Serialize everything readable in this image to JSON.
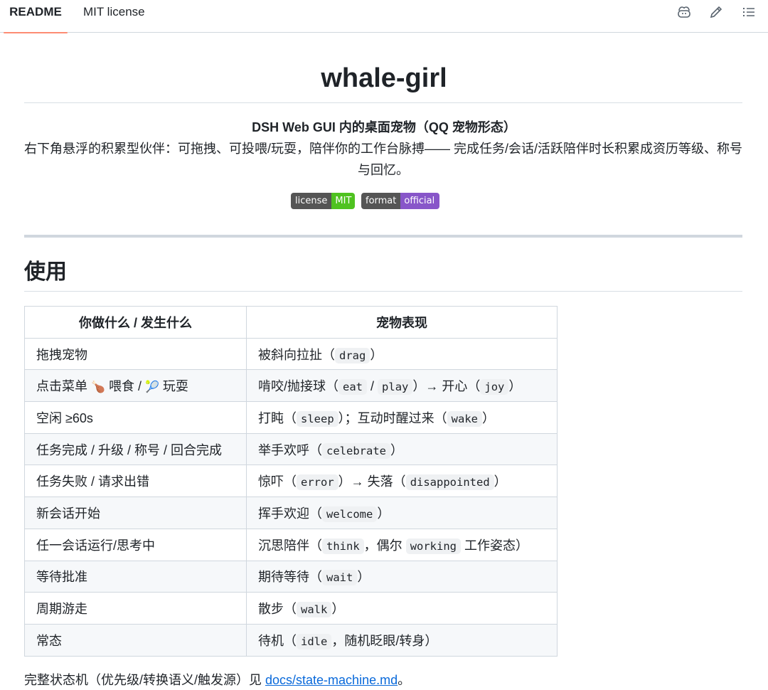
{
  "tabs": [
    {
      "label": "README"
    },
    {
      "label": "MIT license"
    }
  ],
  "toolbar_icons": [
    "copilot-icon",
    "pencil-icon",
    "list-icon"
  ],
  "readme": {
    "title": "whale-girl",
    "subtitle": "DSH Web GUI 内的桌面宠物（QQ 宠物形态）",
    "description": "右下角悬浮的积累型伙伴：可拖拽、可投喂/玩耍，陪伴你的工作台脉搏—— 完成任务/会话/活跃陪伴时长积累成资历等级、称号与回忆。",
    "badges": [
      {
        "left": "license",
        "right": "MIT",
        "color": "#4fc220"
      },
      {
        "left": "format",
        "right": "official bundle",
        "color": "#8856c9"
      }
    ],
    "section_title": "使用",
    "table": {
      "headers": [
        "你做什么 / 发生什么",
        "宠物表现"
      ],
      "rows": [
        {
          "c1": [
            "拖拽宠物"
          ],
          "c2": [
            "被斜向拉扯（",
            "drag",
            "）"
          ]
        },
        {
          "c1": [
            "点击菜单 ",
            "🍗",
            " 喂食 / ",
            "🎾",
            " 玩耍"
          ],
          "c2": [
            "啃咬/抛接球（",
            "eat",
            " / ",
            "play",
            "）→ 开心（",
            "joy",
            "）"
          ]
        },
        {
          "c1": [
            "空闲 ≥60s"
          ],
          "c2": [
            "打盹（",
            "sleep",
            "）；互动时醒过来（",
            "wake",
            "）"
          ]
        },
        {
          "c1": [
            "任务完成 / 升级 / 称号 / 回合完成"
          ],
          "c2": [
            "举手欢呼（",
            "celebrate",
            "）"
          ]
        },
        {
          "c1": [
            "任务失败 / 请求出错"
          ],
          "c2": [
            "惊吓（",
            "error",
            "）→ 失落（",
            "disappointed",
            "）"
          ]
        },
        {
          "c1": [
            "新会话开始"
          ],
          "c2": [
            "挥手欢迎（",
            "welcome",
            "）"
          ]
        },
        {
          "c1": [
            "任一会话运行/思考中"
          ],
          "c2": [
            "沉思陪伴（",
            "think",
            "，偶尔 ",
            "working",
            " 工作姿态）"
          ]
        },
        {
          "c1": [
            "等待批准"
          ],
          "c2": [
            "期待等待（",
            "wait",
            "）"
          ]
        },
        {
          "c1": [
            "周期游走"
          ],
          "c2": [
            "散步（",
            "walk",
            "）"
          ]
        },
        {
          "c1": [
            "常态"
          ],
          "c2": [
            "待机（",
            "idle",
            "，随机眨眼/转身）"
          ]
        }
      ]
    },
    "footer": {
      "text": "完整状态机（优先级/转换语义/触发源）见 ",
      "link": "docs/state-machine.md",
      "end": "。"
    }
  }
}
